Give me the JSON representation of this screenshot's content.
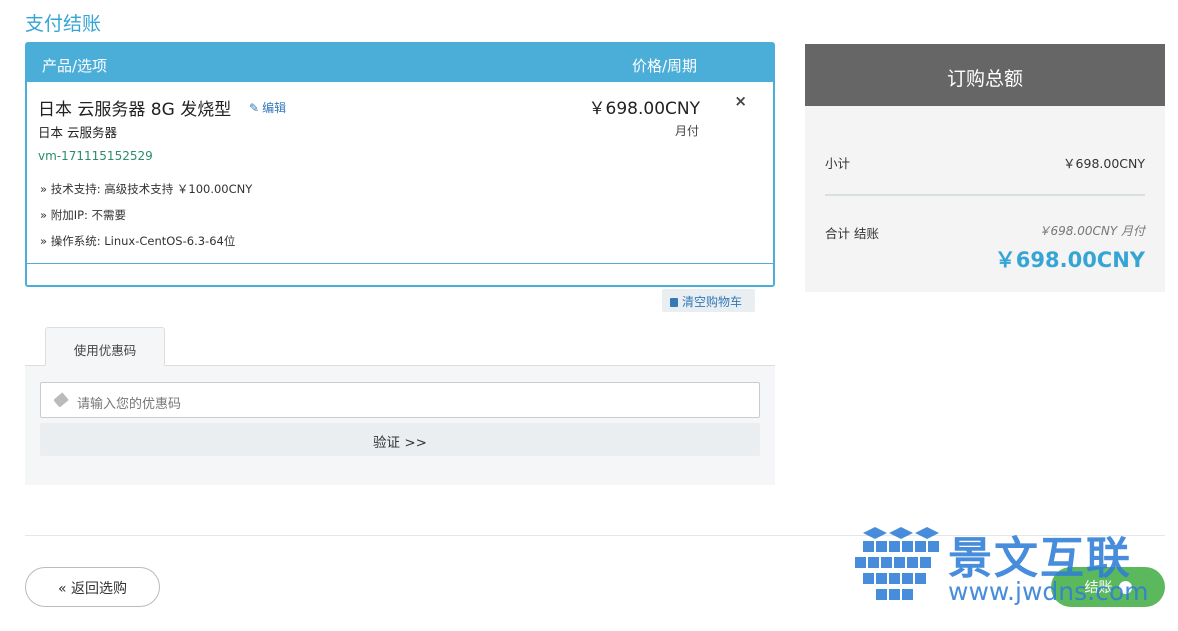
{
  "page": {
    "title": "支付结账"
  },
  "cart": {
    "header": {
      "product": "产品/选项",
      "price": "价格/周期"
    },
    "item": {
      "name": "日本 云服务器 8G 发烧型",
      "edit_label": "编辑",
      "group": "日本 云服务器",
      "domain": "vm-171115152529",
      "options": [
        "» 技术支持: 高级技术支持 ￥100.00CNY",
        "» 附加IP: 不需要",
        "» 操作系统: Linux-CentOS-6.3-64位"
      ],
      "price": "￥698.00CNY",
      "cycle": "月付",
      "remove_icon": "×"
    },
    "empty_cart_label": "清空购物车"
  },
  "promo": {
    "tab_label": "使用优惠码",
    "placeholder": "请输入您的优惠码",
    "verify_label": "验证 >>"
  },
  "summary": {
    "title": "订购总额",
    "subtotal_label": "小计",
    "subtotal_value": "￥698.00CNY",
    "total_label": "合计 结账",
    "recurring": "￥698.00CNY 月付",
    "total_value": "￥698.00CNY"
  },
  "actions": {
    "back_label": "« 返回选购",
    "checkout_label": "结账"
  },
  "watermark": {
    "brand": "景文互联",
    "url": "www.jwdns.com"
  },
  "colors": {
    "accent": "#4aaed9",
    "summary_header": "#666666",
    "checkout": "#5cb85c"
  }
}
